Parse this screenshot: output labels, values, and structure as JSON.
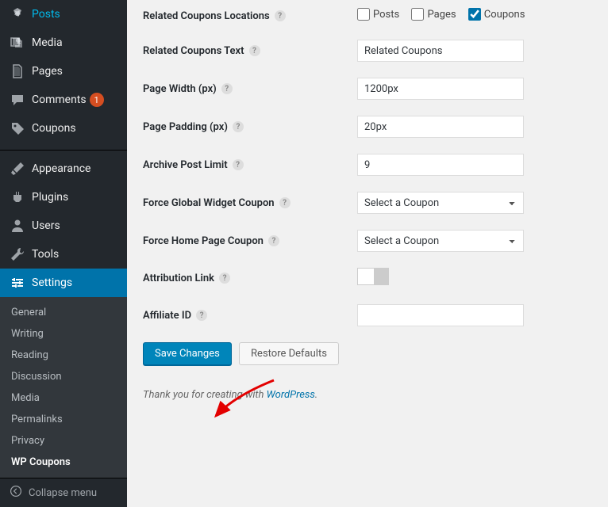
{
  "sidebar": {
    "items": [
      {
        "label": "Posts",
        "icon": "pin"
      },
      {
        "label": "Media",
        "icon": "media"
      },
      {
        "label": "Pages",
        "icon": "page"
      },
      {
        "label": "Comments",
        "icon": "comment",
        "badge": "1"
      },
      {
        "label": "Coupons",
        "icon": "tag"
      }
    ],
    "items2": [
      {
        "label": "Appearance",
        "icon": "brush"
      },
      {
        "label": "Plugins",
        "icon": "plugin"
      },
      {
        "label": "Users",
        "icon": "user"
      },
      {
        "label": "Tools",
        "icon": "wrench"
      },
      {
        "label": "Settings",
        "icon": "sliders",
        "active": true
      }
    ],
    "submenu": [
      "General",
      "Writing",
      "Reading",
      "Discussion",
      "Media",
      "Permalinks",
      "Privacy",
      "WP Coupons"
    ],
    "collapse": "Collapse menu"
  },
  "form": {
    "related_locations": {
      "label": "Related Coupons Locations",
      "posts": "Posts",
      "pages": "Pages",
      "coupons": "Coupons"
    },
    "related_text": {
      "label": "Related Coupons Text",
      "value": "Related Coupons"
    },
    "page_width": {
      "label": "Page Width (px)",
      "value": "1200px"
    },
    "page_padding": {
      "label": "Page Padding (px)",
      "value": "20px"
    },
    "archive_limit": {
      "label": "Archive Post Limit",
      "value": "9"
    },
    "global_widget": {
      "label": "Force Global Widget Coupon",
      "value": "Select a Coupon"
    },
    "home_coupon": {
      "label": "Force Home Page Coupon",
      "value": "Select a Coupon"
    },
    "attribution": {
      "label": "Attribution Link"
    },
    "affiliate_id": {
      "label": "Affiliate ID",
      "value": ""
    },
    "save": "Save Changes",
    "restore": "Restore Defaults"
  },
  "footer": {
    "prefix": "Thank you for creating with ",
    "link": "WordPress"
  }
}
